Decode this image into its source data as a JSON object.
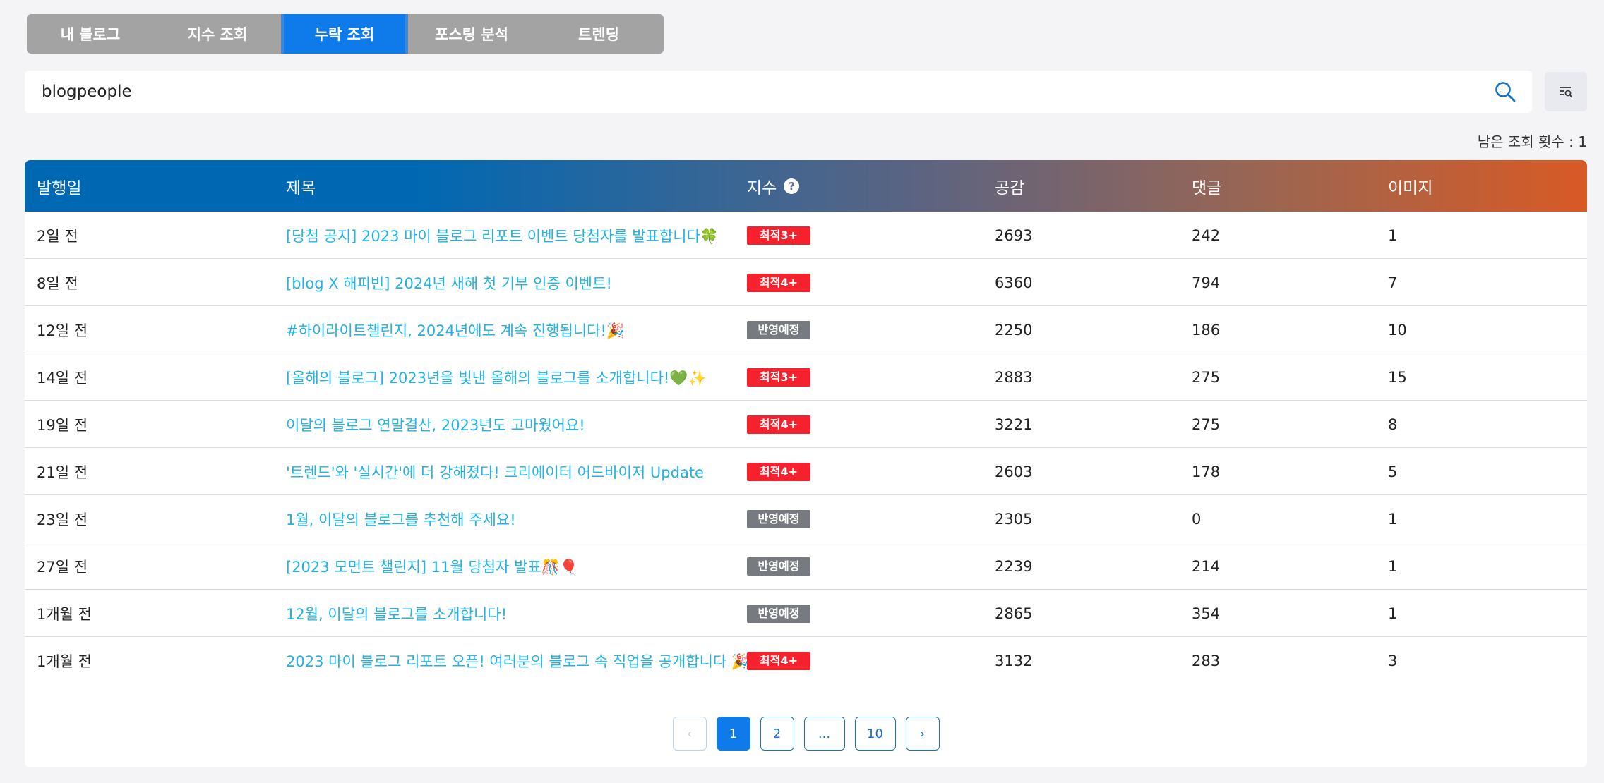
{
  "tabs": [
    {
      "label": "내 블로그",
      "active": false
    },
    {
      "label": "지수 조회",
      "active": false
    },
    {
      "label": "누락 조회",
      "active": true
    },
    {
      "label": "포스팅 분석",
      "active": false
    },
    {
      "label": "트렌딩",
      "active": false
    }
  ],
  "search": {
    "value": "blogpeople",
    "icon": "search-icon"
  },
  "filter_icon": "filter-search-icon",
  "remaining": "남은 조회 횟수 : 1",
  "table": {
    "headers": {
      "date": "발행일",
      "title": "제목",
      "index": "지수",
      "likes": "공감",
      "comments": "댓글",
      "images": "이미지"
    },
    "help_glyph": "?",
    "rows": [
      {
        "date": "2일 전",
        "title": "[당첨 공지] 2023 마이 블로그 리포트 이벤트 당첨자를 발표합니다🍀",
        "badge": "최적3+",
        "badge_color": "red",
        "likes": "2693",
        "comments": "242",
        "images": "1"
      },
      {
        "date": "8일 전",
        "title": "[blog X 해피빈] 2024년 새해 첫 기부 인증 이벤트!",
        "badge": "최적4+",
        "badge_color": "red",
        "likes": "6360",
        "comments": "794",
        "images": "7"
      },
      {
        "date": "12일 전",
        "title": "#하이라이트챌린지, 2024년에도 계속 진행됩니다!🎉",
        "badge": "반영예정",
        "badge_color": "gray",
        "likes": "2250",
        "comments": "186",
        "images": "10"
      },
      {
        "date": "14일 전",
        "title": "[올해의 블로그] 2023년을 빛낸 올해의 블로그를 소개합니다!💚✨",
        "badge": "최적3+",
        "badge_color": "red",
        "likes": "2883",
        "comments": "275",
        "images": "15"
      },
      {
        "date": "19일 전",
        "title": "이달의 블로그 연말결산, 2023년도 고마웠어요!",
        "badge": "최적4+",
        "badge_color": "red",
        "likes": "3221",
        "comments": "275",
        "images": "8"
      },
      {
        "date": "21일 전",
        "title": "'트렌드'와 '실시간'에 더 강해졌다! 크리에이터 어드바이저 Update",
        "badge": "최적4+",
        "badge_color": "red",
        "likes": "2603",
        "comments": "178",
        "images": "5"
      },
      {
        "date": "23일 전",
        "title": "1월, 이달의 블로그를 추천해 주세요!",
        "badge": "반영예정",
        "badge_color": "gray",
        "likes": "2305",
        "comments": "0",
        "images": "1"
      },
      {
        "date": "27일 전",
        "title": "[2023 모먼트 챌린지] 11월 당첨자 발표🎊🎈",
        "badge": "반영예정",
        "badge_color": "gray",
        "likes": "2239",
        "comments": "214",
        "images": "1"
      },
      {
        "date": "1개월 전",
        "title": "12월, 이달의 블로그를 소개합니다!",
        "badge": "반영예정",
        "badge_color": "gray",
        "likes": "2865",
        "comments": "354",
        "images": "1"
      },
      {
        "date": "1개월 전",
        "title": "2023 마이 블로그 리포트 오픈! 여러분의 블로그 속 직업을 공개합니다 🎉",
        "badge": "최적4+",
        "badge_color": "red",
        "likes": "3132",
        "comments": "283",
        "images": "3"
      }
    ]
  },
  "pagination": {
    "prev": "‹",
    "pages": [
      "1",
      "2",
      "...",
      "10"
    ],
    "current": "1",
    "next": "›"
  },
  "colors": {
    "accent": "#0f7bea",
    "badge_red": "#f5222d",
    "badge_gray": "#777a80",
    "link": "#22b2e3"
  }
}
